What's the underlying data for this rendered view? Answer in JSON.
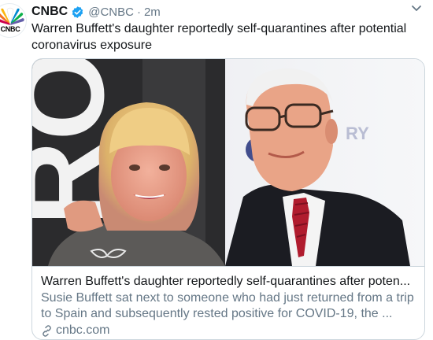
{
  "author": {
    "name": "CNBC",
    "handle": "@CNBC",
    "separator": "·",
    "time": "2m",
    "avatar_text": "CNBC"
  },
  "tweet": {
    "text": "Warren Buffett's daughter reportedly self-quarantines after potential coronavirus exposure"
  },
  "card": {
    "title": "Warren Buffett's daughter reportedly self-quarantines after poten...",
    "description": "Susie Buffett sat next to someone who had just returned from a trip to Spain and subsequently rested positive for COVID-19, the ...",
    "domain": "cnbc.com",
    "backdrop_text": "ROO",
    "backdrop_text_right": "RY"
  },
  "icons": {
    "verified": "verified-badge-icon",
    "chevron": "chevron-down-icon",
    "link": "link-icon",
    "logo": "nbc-peacock-icon"
  },
  "colors": {
    "accent": "#1da1f2",
    "secondary_text": "#657786",
    "border": "#ccd6dd"
  }
}
